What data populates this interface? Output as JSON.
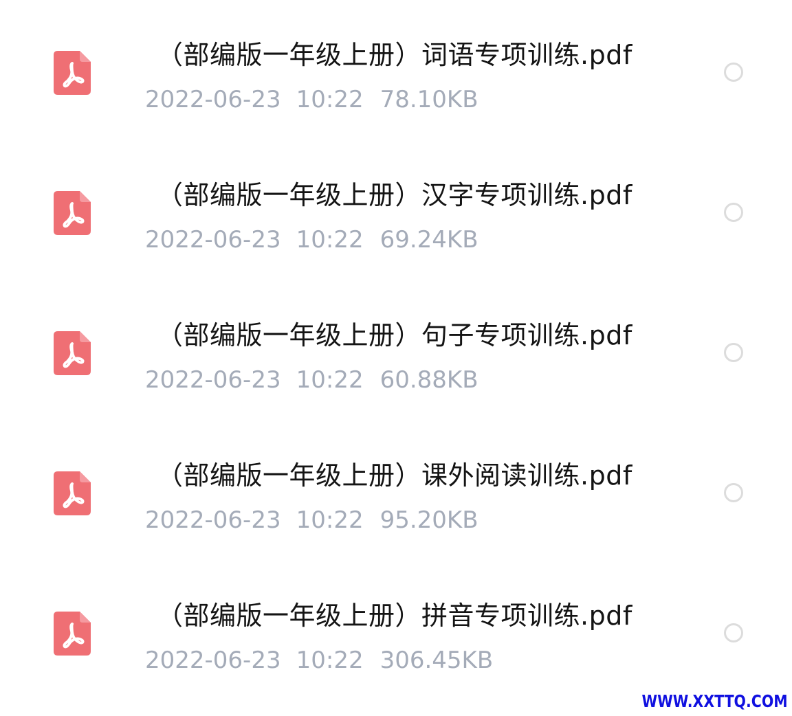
{
  "files": [
    {
      "icon": "pdf-file-icon",
      "name": "（部编版一年级上册）词语专项训练.pdf",
      "date": "2022-06-23",
      "time": "10:22",
      "size": "78.10KB",
      "selected": false
    },
    {
      "icon": "pdf-file-icon",
      "name": "（部编版一年级上册）汉字专项训练.pdf",
      "date": "2022-06-23",
      "time": "10:22",
      "size": "69.24KB",
      "selected": false
    },
    {
      "icon": "pdf-file-icon",
      "name": "（部编版一年级上册）句子专项训练.pdf",
      "date": "2022-06-23",
      "time": "10:22",
      "size": "60.88KB",
      "selected": false
    },
    {
      "icon": "pdf-file-icon",
      "name": "（部编版一年级上册）课外阅读训练.pdf",
      "date": "2022-06-23",
      "time": "10:22",
      "size": "95.20KB",
      "selected": false
    },
    {
      "icon": "pdf-file-icon",
      "name": "（部编版一年级上册）拼音专项训练.pdf",
      "date": "2022-06-23",
      "time": "10:22",
      "size": "306.45KB",
      "selected": false
    }
  ],
  "watermark": {
    "text": "WWW.XXTTQ.COM",
    "color": "#1010e0"
  },
  "colors": {
    "pdf_icon": "#ef6f74",
    "file_name": "#141414",
    "file_meta": "#a4abb8",
    "radio_border": "#dcdcdc"
  }
}
